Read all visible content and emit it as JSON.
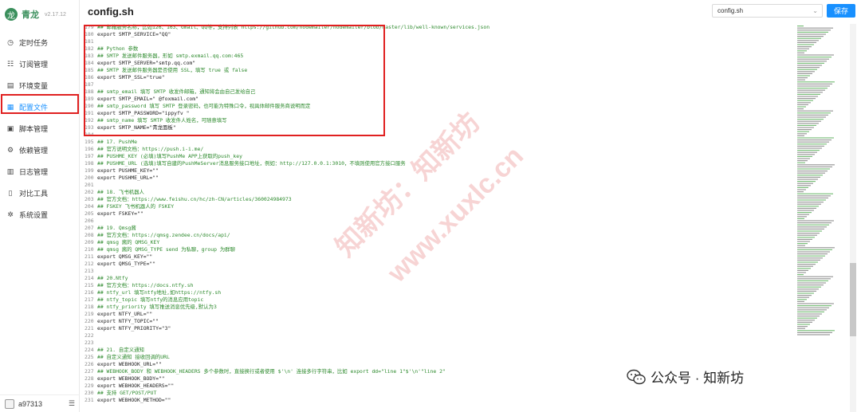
{
  "app": {
    "name": "青龙",
    "version": "v2.17.12"
  },
  "sidebar": {
    "items": [
      {
        "label": "定时任务",
        "icon": "clock-icon"
      },
      {
        "label": "订阅管理",
        "icon": "subscription-icon"
      },
      {
        "label": "环境变量",
        "icon": "variable-icon"
      },
      {
        "label": "配置文件",
        "icon": "config-icon"
      },
      {
        "label": "脚本管理",
        "icon": "script-icon"
      },
      {
        "label": "依赖管理",
        "icon": "dependency-icon"
      },
      {
        "label": "日志管理",
        "icon": "log-icon"
      },
      {
        "label": "对比工具",
        "icon": "diff-icon"
      },
      {
        "label": "系统设置",
        "icon": "settings-icon"
      }
    ],
    "active_index": 3
  },
  "user": {
    "name": "a97313"
  },
  "header": {
    "title": "config.sh",
    "file_select_value": "config.sh",
    "save_label": "保存"
  },
  "editor": {
    "lines": [
      {
        "n": "179",
        "t": "## 邮箱服务名称，比如126、163、Gmail、QQ等，支持列表 https://github.com/nodemailer/nodemailer/blob/master/lib/well-known/services.json"
      },
      {
        "n": "180",
        "t": "export SMTP_SERVICE=\"QQ\""
      },
      {
        "n": "181",
        "t": ""
      },
      {
        "n": "182",
        "t": "## Python 参数"
      },
      {
        "n": "183",
        "t": "## SMTP 发送邮件服务器，形如 smtp.exmail.qq.com:465"
      },
      {
        "n": "184",
        "t": "export SMTP_SERVER=\"smtp.qq.com\""
      },
      {
        "n": "185",
        "t": "## SMTP 发送邮件服务器是否使用 SSL，填写 true 或 false"
      },
      {
        "n": "186",
        "t": "export SMTP_SSL=\"true\""
      },
      {
        "n": "187",
        "t": ""
      },
      {
        "n": "188",
        "t": "## smtp_email 填写 SMTP 收发件邮箱，通知将会由自己发给自己"
      },
      {
        "n": "189",
        "t": "export SMTP_EMAIL=\"        @foxmail.com\""
      },
      {
        "n": "190",
        "t": "## smtp_password 填写 SMTP 登录密码，也可能为特殊口令，视具体邮件服务商说明而定"
      },
      {
        "n": "191",
        "t": "export SMTP_PASSWORD=\"ippyfv            \""
      },
      {
        "n": "192",
        "t": "## smtp_name 填写 SMTP 收发件人姓名，可随意填写"
      },
      {
        "n": "193",
        "t": "export SMTP_NAME=\"青龙面板\""
      },
      {
        "n": "194",
        "t": ""
      },
      {
        "n": "195",
        "t": "## 17. PushMe"
      },
      {
        "n": "196",
        "t": "## 官方说明文档：https://push.i-i.me/"
      },
      {
        "n": "197",
        "t": "## PUSHME_KEY (必填)填写PushMe APP上获取的push_key"
      },
      {
        "n": "198",
        "t": "## PUSHME_URL (选填)填写自建的PushMeServer消息服务接口地址，例如：http://127.0.0.1:3010，不填则使用官方接口服务"
      },
      {
        "n": "199",
        "t": "export PUSHME_KEY=\"\""
      },
      {
        "n": "200",
        "t": "export PUSHME_URL=\"\""
      },
      {
        "n": "201",
        "t": ""
      },
      {
        "n": "202",
        "t": "## 18. 飞书机器人"
      },
      {
        "n": "203",
        "t": "## 官方文档：https://www.feishu.cn/hc/zh-CN/articles/360024984973"
      },
      {
        "n": "204",
        "t": "## FSKEY 飞书机器人的 FSKEY"
      },
      {
        "n": "205",
        "t": "export FSKEY=\"\""
      },
      {
        "n": "206",
        "t": ""
      },
      {
        "n": "207",
        "t": "## 19. Qmsg酱"
      },
      {
        "n": "208",
        "t": "## 官方文档：https://qmsg.zendee.cn/docs/api/"
      },
      {
        "n": "209",
        "t": "## qmsg 酱的 QMSG_KEY"
      },
      {
        "n": "210",
        "t": "## qmsg 酱的 QMSG_TYPE send 为私聊，group 为群聊"
      },
      {
        "n": "211",
        "t": "export QMSG_KEY=\"\""
      },
      {
        "n": "212",
        "t": "export QMSG_TYPE=\"\""
      },
      {
        "n": "213",
        "t": ""
      },
      {
        "n": "214",
        "t": "## 20.Ntfy"
      },
      {
        "n": "215",
        "t": "## 官方文档：https://docs.ntfy.sh"
      },
      {
        "n": "216",
        "t": "## ntfy_url 填写ntfy地址,如https://ntfy.sh"
      },
      {
        "n": "217",
        "t": "## ntfy_topic 填写ntfy的消息应用topic"
      },
      {
        "n": "218",
        "t": "## ntfy_priority 填写推送消息优先级,默认为3"
      },
      {
        "n": "219",
        "t": "export NTFY_URL=\"\""
      },
      {
        "n": "220",
        "t": "export NTFY_TOPIC=\"\""
      },
      {
        "n": "221",
        "t": "export NTFY_PRIORITY=\"3\""
      },
      {
        "n": "222",
        "t": ""
      },
      {
        "n": "223",
        "t": ""
      },
      {
        "n": "224",
        "t": "## 21. 自定义通知"
      },
      {
        "n": "225",
        "t": "## 自定义通知 接收回调的URL"
      },
      {
        "n": "226",
        "t": "export WEBHOOK_URL=\"\""
      },
      {
        "n": "227",
        "t": "## WEBHOOK_BODY 和 WEBHOOK_HEADERS 多个参数时，直接换行或者使用 $'\\n' 连接多行字符串，比如 export dd=\"line 1\"$'\\n'\"line 2\""
      },
      {
        "n": "228",
        "t": "export WEBHOOK_BODY=\"\""
      },
      {
        "n": "229",
        "t": "export WEBHOOK_HEADERS=\"\""
      },
      {
        "n": "230",
        "t": "## 支持 GET/POST/PUT"
      },
      {
        "n": "231",
        "t": "export WEBHOOK_METHOD=\"\""
      }
    ]
  },
  "watermark": {
    "line1": "知新坊：知新坊",
    "line2": "www.xuxlc.cn",
    "footer": "公众号 · 知新坊"
  },
  "colors": {
    "accent": "#1890ff",
    "brand": "#3a8f5c",
    "highlight": "#e02020",
    "comment": "#2d8a2d"
  }
}
